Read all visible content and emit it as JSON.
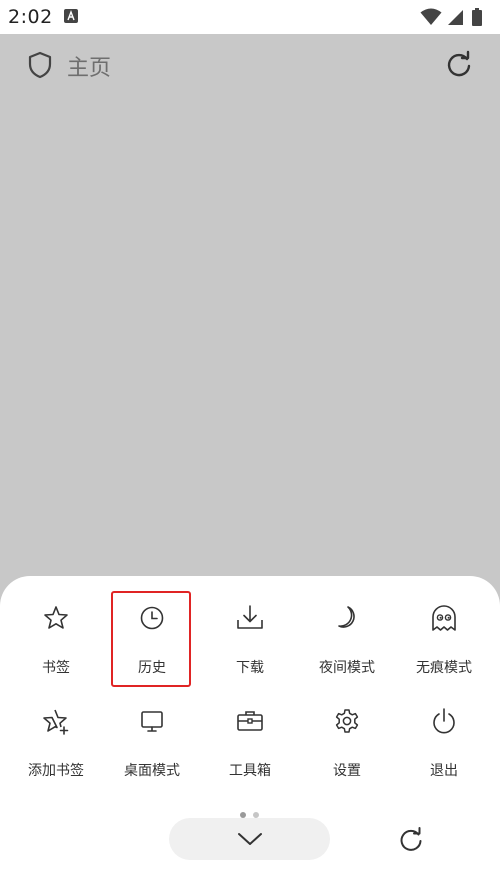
{
  "status_bar": {
    "time": "2:02"
  },
  "address_bar": {
    "title": "主页"
  },
  "menu": {
    "items": [
      {
        "label": "书签",
        "icon": "star-icon"
      },
      {
        "label": "历史",
        "icon": "clock-icon"
      },
      {
        "label": "下载",
        "icon": "download-icon"
      },
      {
        "label": "夜间模式",
        "icon": "moon-icon"
      },
      {
        "label": "无痕模式",
        "icon": "ghost-icon"
      },
      {
        "label": "添加书签",
        "icon": "star-plus-icon"
      },
      {
        "label": "桌面模式",
        "icon": "monitor-icon"
      },
      {
        "label": "工具箱",
        "icon": "toolbox-icon"
      },
      {
        "label": "设置",
        "icon": "gear-icon"
      },
      {
        "label": "退出",
        "icon": "power-icon"
      }
    ],
    "highlighted_item": "历史"
  },
  "colors": {
    "page_background": "#c8c8c8",
    "highlight": "#e02424",
    "sheet_background": "#ffffff"
  }
}
